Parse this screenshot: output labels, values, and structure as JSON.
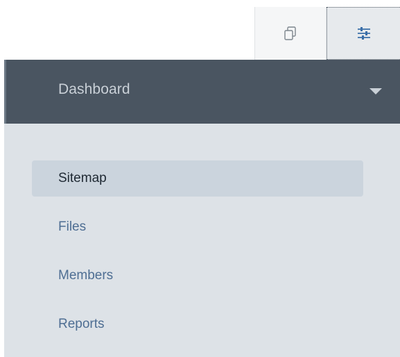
{
  "toolbar": {
    "pages_icon": "pages-icon",
    "settings_icon": "sliders-icon"
  },
  "panel": {
    "header": {
      "title": "Dashboard",
      "caret_icon": "caret-down-icon"
    },
    "nav": {
      "items": [
        {
          "label": "Sitemap",
          "active": true
        },
        {
          "label": "Files",
          "active": false
        },
        {
          "label": "Members",
          "active": false
        },
        {
          "label": "Reports",
          "active": false
        }
      ]
    }
  },
  "colors": {
    "header_bg": "#4a5561",
    "panel_bg": "#dde2e7",
    "active_item_bg": "#cbd4dd",
    "link_color": "#4e6e93",
    "accent_icon": "#3a6ea8"
  }
}
